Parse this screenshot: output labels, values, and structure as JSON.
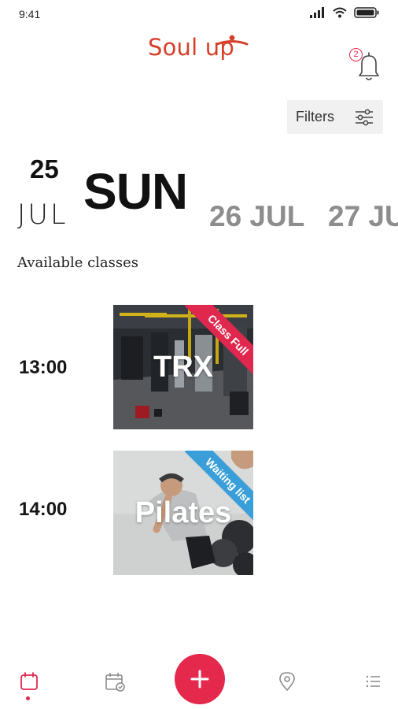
{
  "status_bar": {
    "time": "9:41",
    "icons": [
      "signal-icon",
      "wifi-icon",
      "battery-icon"
    ]
  },
  "header": {
    "logo_text": "Soul up",
    "notifications": {
      "icon": "bell-icon",
      "badge": "2"
    }
  },
  "filters": {
    "label": "Filters",
    "icon": "sliders-icon"
  },
  "dates": {
    "selected": {
      "day": "25",
      "weekday": "SUN",
      "month": "JUL"
    },
    "upcoming": [
      {
        "label": "26 JUL"
      },
      {
        "label": "27 JU"
      }
    ]
  },
  "section_title": "Available classes",
  "classes": [
    {
      "time": "13:00",
      "name": "TRX",
      "status": "Class Full",
      "status_color": "#e0284f"
    },
    {
      "time": "14:00",
      "name": "Pilates",
      "status": "Waiting list",
      "status_color": "#3a9fd8"
    }
  ],
  "bottom_nav": {
    "items": [
      "schedule-icon",
      "calendar-check-icon",
      "add-icon",
      "location-pin-icon",
      "list-icon"
    ],
    "active": "schedule-icon"
  },
  "colors": {
    "brand_red": "#d6402a",
    "accent_pink": "#e4294d",
    "waiting_blue": "#3a9fd8"
  }
}
